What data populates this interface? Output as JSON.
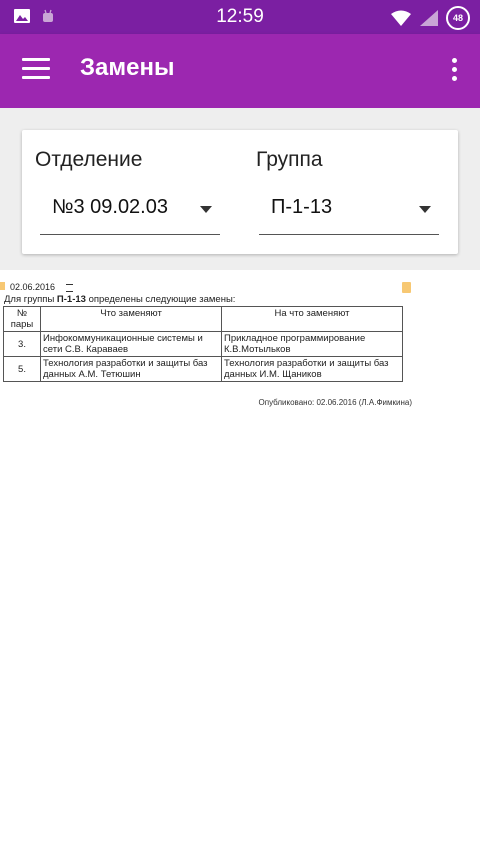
{
  "status_bar": {
    "time": "12:59",
    "battery": "48",
    "icons": [
      "image-icon",
      "android-debug-icon",
      "wifi-icon",
      "cell-signal-icon",
      "battery-icon"
    ]
  },
  "app_bar": {
    "title": "Замены",
    "menu_icon": "hamburger-menu-icon",
    "overflow_icon": "more-vert-icon"
  },
  "selectors": {
    "department": {
      "label": "Отделение",
      "value": "№3 09.02.03"
    },
    "group": {
      "label": "Группа",
      "value": "П-1-13"
    }
  },
  "document": {
    "date": "02.06.2016",
    "intro_prefix": "Для группы ",
    "intro_group": "П-1-13",
    "intro_suffix": " определены следующие замены:",
    "table": {
      "headers": [
        "№ пары",
        "Что заменяют",
        "На что заменяют"
      ],
      "rows": [
        {
          "num": "3.",
          "what": "Инфокоммуникационные системы и сети С.В. Караваев",
          "with": "Прикладное программирование К.В.Мотыльков"
        },
        {
          "num": "5.",
          "what": "Технология разработки и защиты баз данных А.М. Тетюшин",
          "with": "Технология разработки и защиты баз данных И.М. Щаников"
        }
      ]
    },
    "published": "Опубликовано: 02.06.2016 (Л.А.Фимкина)"
  },
  "colors": {
    "status_bar": "#7b1fa2",
    "app_bar": "#9c27b0",
    "marker": "#f7c873"
  }
}
